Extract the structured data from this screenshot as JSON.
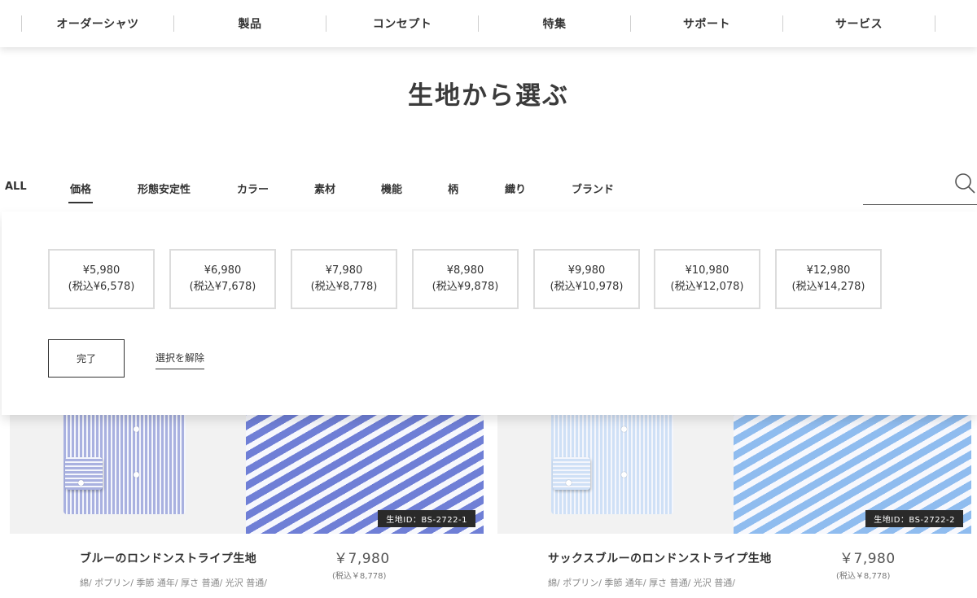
{
  "nav": {
    "items": [
      "オーダーシャツ",
      "製品",
      "コンセプト",
      "特集",
      "サポート",
      "サービス"
    ]
  },
  "page": {
    "title": "生地から選ぶ"
  },
  "filters": {
    "tabs": [
      "ALL",
      "価格",
      "形態安定性",
      "カラー",
      "素材",
      "機能",
      "柄",
      "織り",
      "ブランド"
    ],
    "active_tab": "価格"
  },
  "panel": {
    "prices": [
      {
        "price": "¥5,980",
        "tax": "(税込¥6,578)"
      },
      {
        "price": "¥6,980",
        "tax": "(税込¥7,678)"
      },
      {
        "price": "¥7,980",
        "tax": "(税込¥8,778)"
      },
      {
        "price": "¥8,980",
        "tax": "(税込¥9,878)"
      },
      {
        "price": "¥9,980",
        "tax": "(税込¥10,978)"
      },
      {
        "price": "¥10,980",
        "tax": "(税込¥12,078)"
      },
      {
        "price": "¥12,980",
        "tax": "(税込¥14,278)"
      }
    ],
    "done_label": "完了",
    "clear_label": "選択を解除"
  },
  "products": [
    {
      "fabric_id": "生地ID：BS-2722-1",
      "name": "ブルーのロンドンストライプ生地",
      "price": "￥7,980",
      "price_tax": "(税込￥8,778)",
      "tags": "綿/ ポプリン/ 季節 通年/ 厚さ 普通/ 光沢 普通/",
      "stripe_color": "#6f7fd6",
      "shirt_color": "#a9b1e0"
    },
    {
      "fabric_id": "生地ID：BS-2722-2",
      "name": "サックスブルーのロンドンストライプ生地",
      "price": "￥7,980",
      "price_tax": "(税込￥8,778)",
      "tags": "綿/ ポプリン/ 季節 通年/ 厚さ 普通/ 光沢 普通/",
      "stripe_color": "#8fbcef",
      "shirt_color": "#cfe0f6"
    }
  ]
}
